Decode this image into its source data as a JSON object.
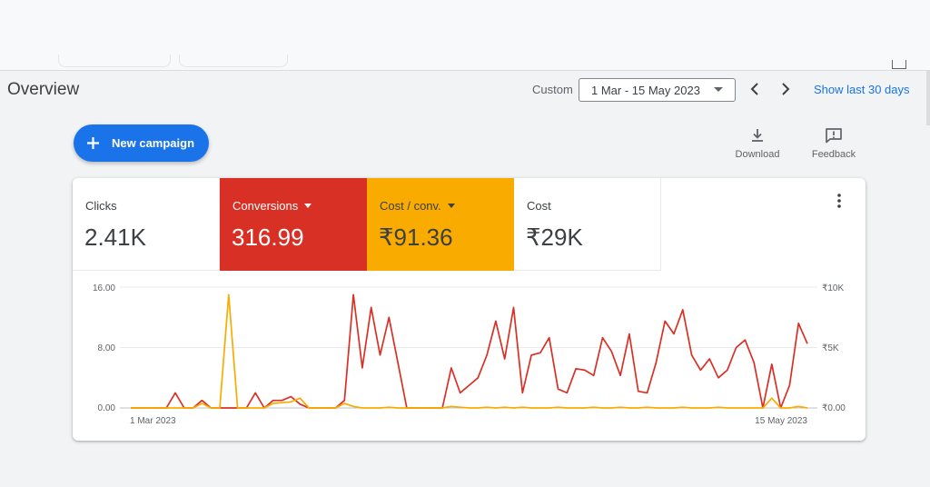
{
  "page": {
    "title": "Overview"
  },
  "date_range": {
    "preset_label": "Custom",
    "value": "1 Mar - 15 May 2023",
    "show_last_label": "Show last 30 days"
  },
  "actions": {
    "new_campaign_label": "New campaign",
    "download_label": "Download",
    "feedback_label": "Feedback"
  },
  "colors": {
    "accent": "#1a73e8",
    "conversions": "#d93025",
    "cost_per_conv": "#f9ab00"
  },
  "metrics": [
    {
      "label": "Clicks",
      "value": "2.41K",
      "selected": false
    },
    {
      "label": "Conversions",
      "value": "316.99",
      "selected": true
    },
    {
      "label": "Cost / conv.",
      "value": "₹91.36",
      "selected": true
    },
    {
      "label": "Cost",
      "value": "₹29K",
      "selected": false
    }
  ],
  "chart_data": {
    "type": "line",
    "x_start_label": "1 Mar 2023",
    "x_end_label": "15 May 2023",
    "left_axis": {
      "ticks": [
        "16.00",
        "8.00",
        "0.00"
      ],
      "range": [
        0,
        16
      ]
    },
    "right_axis": {
      "ticks": [
        "₹10K",
        "₹5K",
        "₹0.00"
      ],
      "range": [
        0,
        10000
      ]
    },
    "grid": true,
    "series": [
      {
        "name": "Conversions",
        "color": "#d93025",
        "axis": "left",
        "values": [
          0,
          0,
          0,
          0,
          0,
          2,
          0,
          0,
          1,
          0,
          0,
          0,
          0,
          0,
          2,
          0,
          1,
          1,
          1.5,
          0.5,
          0,
          0,
          0,
          0,
          1,
          15,
          5.3,
          13.3,
          7,
          12,
          6,
          0,
          0,
          0,
          0,
          0,
          5.3,
          2,
          3,
          4,
          7,
          11.5,
          6.5,
          13.3,
          2,
          7,
          7.3,
          9.3,
          2.5,
          2,
          5.2,
          5,
          4.3,
          9.3,
          7.5,
          4.3,
          9.8,
          2.2,
          2,
          6,
          11.5,
          9.8,
          13,
          7,
          5,
          6.5,
          4,
          5,
          8,
          9,
          6,
          0,
          5.8,
          0,
          3,
          11.2,
          8.5
        ]
      },
      {
        "name": "Cost / conv.",
        "color": "#f9ab00",
        "axis": "left",
        "values": [
          0,
          0,
          0,
          0,
          0,
          0,
          0,
          0,
          0.6,
          0,
          0,
          15,
          0,
          0,
          0,
          0,
          0.6,
          0.7,
          0.8,
          1.3,
          0,
          0,
          0,
          0,
          0.6,
          0.2,
          0,
          0,
          0,
          0.1,
          0,
          0,
          0,
          0,
          0,
          0,
          0.2,
          0.1,
          0,
          0,
          0.1,
          0,
          0.1,
          0,
          0.1,
          0,
          0,
          0,
          0.1,
          0,
          0,
          0,
          0.1,
          0,
          0,
          0.1,
          0,
          0,
          0.1,
          0,
          0,
          0,
          0.1,
          0,
          0,
          0,
          0.1,
          0,
          0,
          0,
          0,
          0,
          1.3,
          0,
          0,
          0.2,
          0
        ]
      }
    ]
  }
}
